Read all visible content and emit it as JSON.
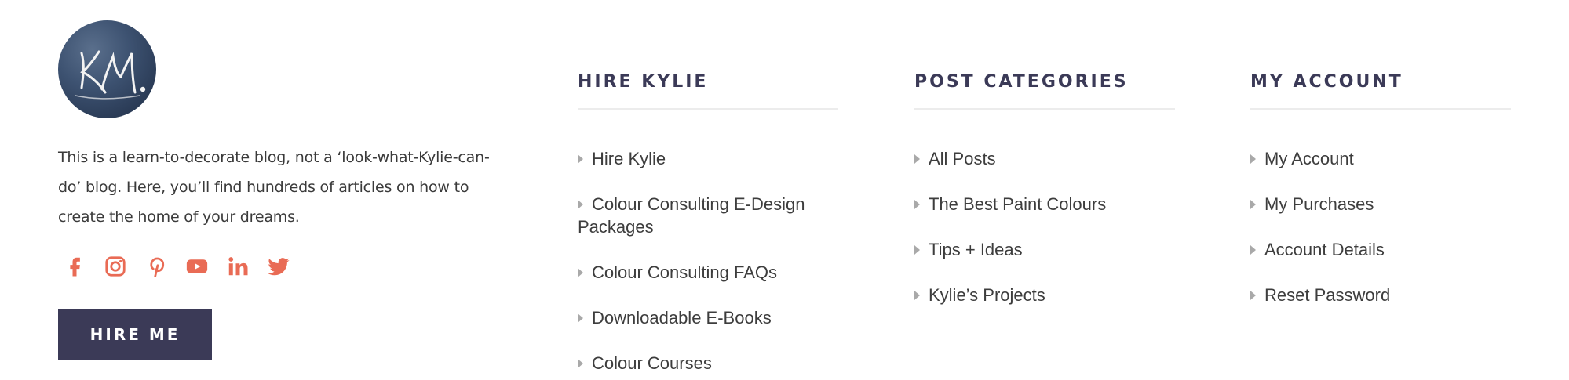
{
  "logo": {
    "initials": "KM."
  },
  "about": {
    "text": "This is a learn-to-decorate blog, not a ‘look-what-Kylie-can-do’ blog. Here, you’ll find hundreds of articles on how to create the home of your dreams."
  },
  "social": {
    "color": "#e96b55",
    "icons": [
      "facebook-icon",
      "instagram-icon",
      "pinterest-icon",
      "youtube-icon",
      "linkedin-icon",
      "twitter-icon"
    ]
  },
  "hire_button": {
    "label": "HIRE ME",
    "background": "#3b3a57"
  },
  "columns": [
    {
      "title": "HIRE KYLIE",
      "items": [
        "Hire Kylie",
        "Colour Consulting E-Design Packages",
        "Colour Consulting FAQs",
        "Downloadable E-Books",
        "Colour Courses"
      ]
    },
    {
      "title": "POST CATEGORIES",
      "items": [
        "All Posts",
        "The Best Paint Colours",
        "Tips + Ideas",
        "Kylie’s Projects"
      ]
    },
    {
      "title": "MY ACCOUNT",
      "items": [
        "My Account",
        "My Purchases",
        "Account Details",
        "Reset Password"
      ]
    }
  ],
  "colors": {
    "heading": "#3b3a57",
    "link": "#3d3d3d",
    "bullet": "#a9a9a9",
    "rule": "#ececec"
  }
}
